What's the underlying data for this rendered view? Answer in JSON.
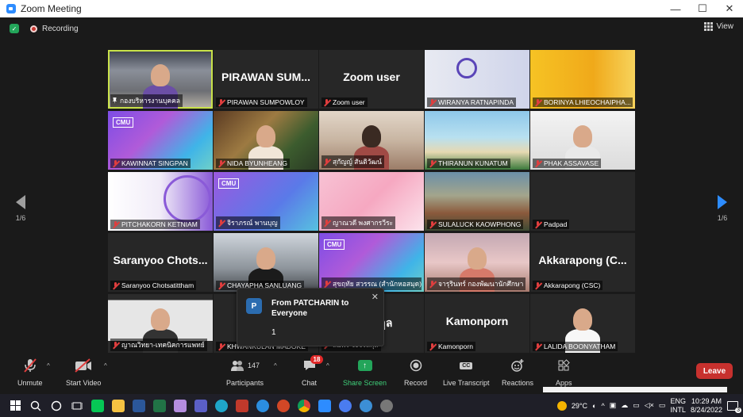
{
  "window": {
    "title": "Zoom Meeting",
    "minimize": "—",
    "maximize": "☐",
    "close": "✕"
  },
  "meeting": {
    "recording_label": "Recording",
    "view_label": "View"
  },
  "participants": [
    {
      "name": "กองบริหารงานบุคคล",
      "bigname": "",
      "bg": "office",
      "muted": false,
      "pinned": true
    },
    {
      "name": "PIRAWAN SUMPOWLOY",
      "bigname": "PIRAWAN SUM...",
      "bg": "none",
      "muted": true
    },
    {
      "name": "Zoom user",
      "bigname": "Zoom user",
      "bg": "none",
      "muted": true
    },
    {
      "name": "WIRANYA RATNAPINDA",
      "bigname": "",
      "bg": "logo",
      "muted": true
    },
    {
      "name": "BORINYA LHIEOCHAIPHA...",
      "bigname": "",
      "bg": "yellow",
      "muted": true
    },
    {
      "name": "KAWINNAT SINGPAN",
      "bigname": "",
      "bg": "cmu",
      "muted": true
    },
    {
      "name": "NIDA BYUNHEANG",
      "bigname": "",
      "bg": "xmas",
      "muted": true
    },
    {
      "name": "สุกัญญ์ สันติวัฒน์",
      "bigname": "",
      "bg": "room",
      "muted": true
    },
    {
      "name": "THIRANUN KUNATUM",
      "bigname": "",
      "bg": "beach",
      "muted": true
    },
    {
      "name": "PHAK ASSAVASE",
      "bigname": "",
      "bg": "white",
      "muted": true
    },
    {
      "name": "PITCHAKORN KETNIAM",
      "bigname": "",
      "bg": "purplewhite",
      "muted": true
    },
    {
      "name": "จิราภรณ์ พานบุญ",
      "bigname": "",
      "bg": "cmu2",
      "muted": true
    },
    {
      "name": "ญาณวดี พงศากรวีระ",
      "bigname": "",
      "bg": "pink",
      "muted": true
    },
    {
      "name": "SULALUCK KAOWPHONG",
      "bigname": "",
      "bg": "building",
      "muted": true
    },
    {
      "name": "Padpad",
      "bigname": "",
      "bg": "none",
      "muted": true
    },
    {
      "name": "Saranyoo Chotsatittham",
      "bigname": "Saranyoo Chots...",
      "bg": "none",
      "muted": true
    },
    {
      "name": "CHAYAPHA SANLUANG",
      "bigname": "",
      "bg": "lab",
      "muted": true
    },
    {
      "name": "สุขฤทัย สวรรณ (สำนักหอสมุด)",
      "bigname": "",
      "bg": "cmu",
      "muted": true
    },
    {
      "name": "จารุรินทร์ กองพัฒนานักศึกษา",
      "bigname": "",
      "bg": "pink2",
      "muted": true
    },
    {
      "name": "Akkarapong (CSC)",
      "bigname": "Akkarapong (C...",
      "bg": "none",
      "muted": true
    },
    {
      "name": "ญาณวิทยา-เทคนิคการแพทย์",
      "bigname": "",
      "bg": "man",
      "muted": true
    },
    {
      "name": "KHWANKULAN MADOKE",
      "bigname": "",
      "bg": "none",
      "muted": true
    },
    {
      "name": "สมพร จงจรัสกุล",
      "bigname": "...ตระกูล",
      "bg": "none",
      "muted": true
    },
    {
      "name": "Kamonporn",
      "bigname": "Kamonporn",
      "bg": "none",
      "muted": true
    },
    {
      "name": "LALIDA BOONYATHAM",
      "bigname": "",
      "bg": "woman",
      "muted": true
    }
  ],
  "pagination": {
    "left_page": "1/6",
    "right_page": "1/6"
  },
  "chat_popup": {
    "avatar_letter": "P",
    "from": "From PATCHARIN to Everyone",
    "message": "1",
    "close": "✕"
  },
  "toolbar": {
    "unmute": "Unmute",
    "start_video": "Start Video",
    "participants_count": "147",
    "participants": "Participants",
    "chat_badge": "18",
    "chat": "Chat",
    "share_screen": "Share Screen",
    "record": "Record",
    "live_transcript": "Live Transcript",
    "cc_icon_text": "CC",
    "reactions": "Reactions",
    "apps": "Apps",
    "leave": "Leave"
  },
  "taskbar": {
    "weather": "29°C",
    "lang_top": "ENG",
    "lang_bottom": "INTL",
    "time": "10:29 AM",
    "date": "8/24/2022",
    "notif_count": "3"
  }
}
